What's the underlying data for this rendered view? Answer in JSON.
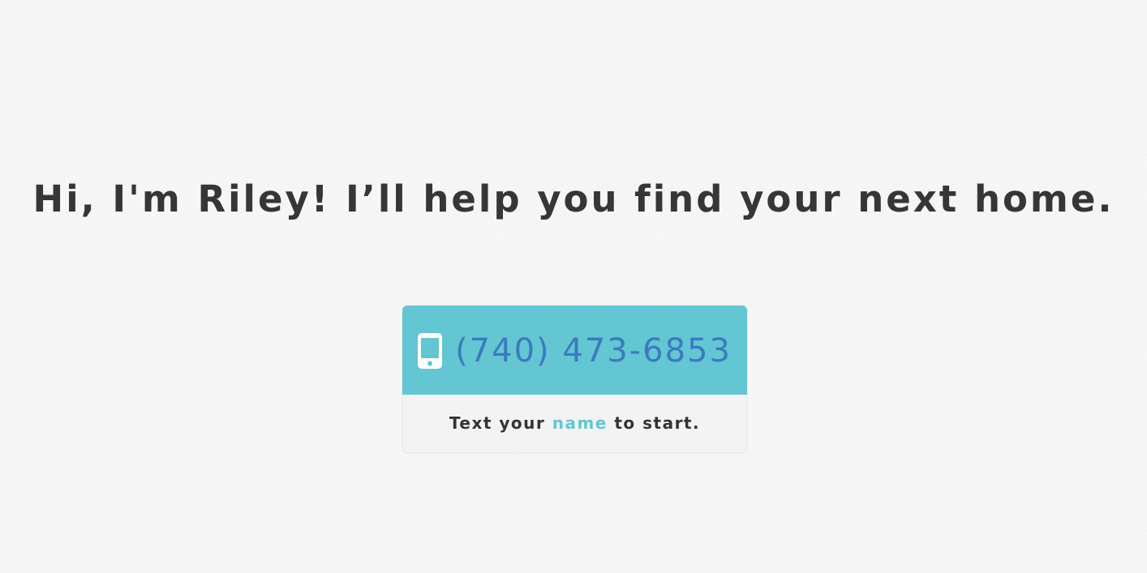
{
  "headline": "Hi, I'm Riley! I’ll help you find your next home.",
  "contact": {
    "icon": "mobile-phone-icon",
    "phone_number": "(740) 473-6853"
  },
  "instruction": {
    "prefix": "Text your ",
    "highlight": "name",
    "suffix": " to start."
  },
  "colors": {
    "accent": "#63c6d2",
    "phone_text": "#3a7bbf",
    "headline_text": "#363636",
    "panel_background": "#f3f3f3",
    "page_background": "#f7f7f7"
  }
}
